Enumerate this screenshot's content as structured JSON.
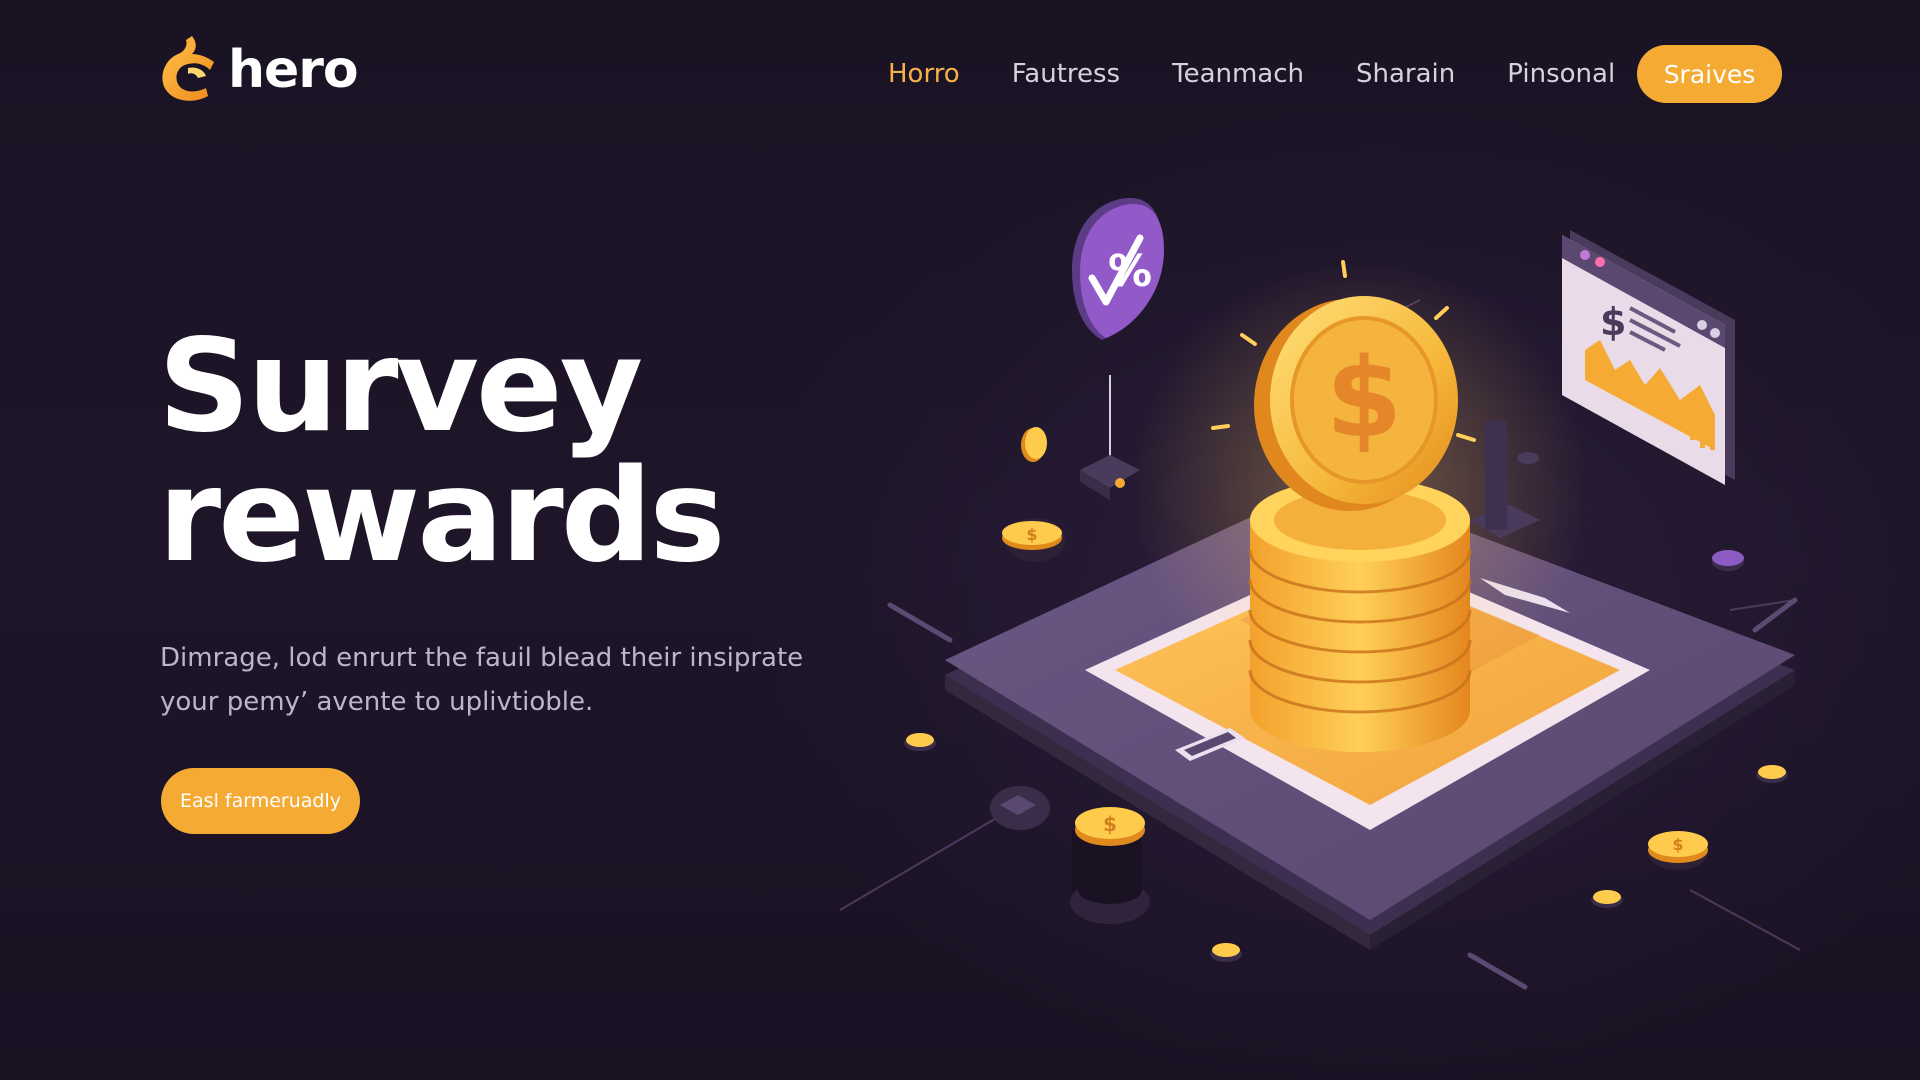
{
  "brand": {
    "name": "hero",
    "accent_color": "#f5aa34",
    "background_color": "#1c1426"
  },
  "nav": {
    "items": [
      {
        "label": "Horro",
        "active": true
      },
      {
        "label": "Fautress",
        "active": false
      },
      {
        "label": "Teanmach",
        "active": false
      },
      {
        "label": "Sharain",
        "active": false
      },
      {
        "label": "Pinsonal",
        "active": false
      }
    ],
    "cta_label": "Sraives"
  },
  "hero": {
    "title_line1": "Survey",
    "title_line2": "rewards",
    "description": "Dimrage, lod enrurt the fauil blead their insiprate your pemy’ avente to uplivtioble.",
    "cta_label": "Easl farmeruadly"
  },
  "illustration": {
    "badge_symbol": "%",
    "coin_symbol": "$",
    "icons": [
      "percent-check-badge-icon",
      "dollar-coin-icon",
      "coin-stack-icon",
      "analytics-monitor-icon",
      "platform-icon"
    ]
  }
}
